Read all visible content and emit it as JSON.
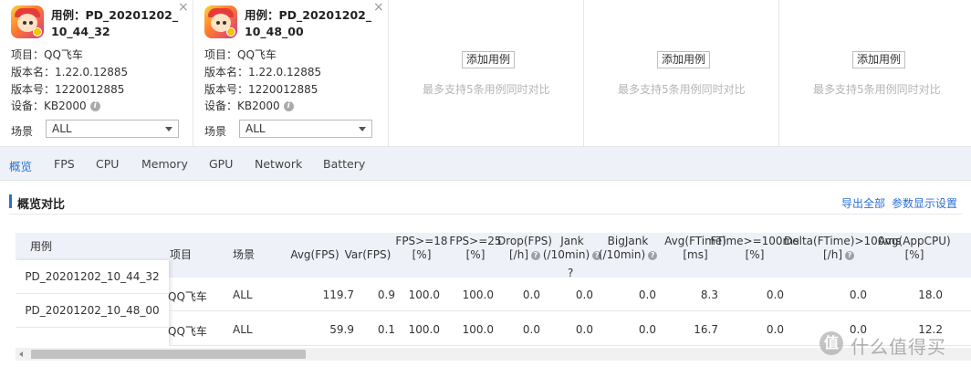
{
  "cases": [
    {
      "title": "用例：PD_20201202_10_44_32",
      "close": "×",
      "project": "项目：QQ飞车",
      "version_name": "版本名：1.22.0.12885",
      "version_code": "版本号：1220012885",
      "device": "设备：KB2000",
      "scene_label": "场景",
      "scene_value": "ALL"
    },
    {
      "title": "用例：PD_20201202_10_48_00",
      "close": "×",
      "project": "项目：QQ飞车",
      "version_name": "版本名：1.22.0.12885",
      "version_code": "版本号：1220012885",
      "device": "设备：KB2000",
      "scene_label": "场景",
      "scene_value": "ALL"
    }
  ],
  "empty_slots": [
    {
      "add_label": "添加用例",
      "hint": "最多支持5条用例同时对比"
    },
    {
      "add_label": "添加用例",
      "hint": "最多支持5条用例同时对比"
    },
    {
      "add_label": "添加用例",
      "hint": "最多支持5条用例同时对比"
    }
  ],
  "tabs": [
    "概览",
    "FPS",
    "CPU",
    "Memory",
    "GPU",
    "Network",
    "Battery"
  ],
  "active_tab": "概览",
  "section": {
    "title": "概览对比",
    "export_all": "导出全部",
    "param_settings": "参数显示设置"
  },
  "table": {
    "case_header": "用例",
    "headers": [
      [
        "项目"
      ],
      [
        "场景"
      ],
      [
        "Avg(FPS)"
      ],
      [
        "Var(FPS)"
      ],
      [
        "FPS>=18",
        "[%]"
      ],
      [
        "FPS>=25",
        "[%]"
      ],
      [
        "Drop(FPS)",
        "[/h]"
      ],
      [
        "Jank",
        "(/10min)"
      ],
      [
        "BigJank",
        "(/10min)"
      ],
      [
        "Avg(FTime)",
        "[ms]"
      ],
      [
        "FTime>=100ms",
        "[%]"
      ],
      [
        "Delta(FTime)>100ms",
        "[/h]"
      ],
      [
        "Avg(AppCPU)",
        "[%]"
      ]
    ],
    "rows": [
      {
        "case": "PD_20201202_10_44_32",
        "cells": [
          "QQ飞车",
          "ALL",
          "119.7",
          "0.9",
          "100.0",
          "100.0",
          "0.0",
          "0.0",
          "0.0",
          "8.3",
          "0.0",
          "0.0",
          "18.0"
        ]
      },
      {
        "case": "PD_20201202_10_48_00",
        "cells": [
          "QQ飞车",
          "ALL",
          "59.9",
          "0.1",
          "100.0",
          "100.0",
          "0.0",
          "0.0",
          "0.0",
          "16.7",
          "0.0",
          "0.0",
          "12.2"
        ]
      }
    ]
  },
  "watermark": {
    "logo": "值",
    "text": "什么值得买"
  },
  "colors": {
    "accent": "#2a6fd6",
    "tab_bg": "#eef1f7",
    "header_bg": "#eef1f7"
  }
}
